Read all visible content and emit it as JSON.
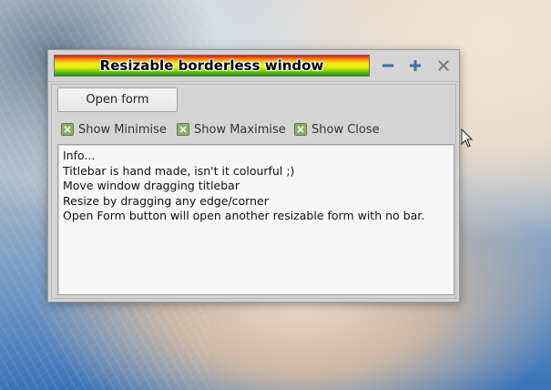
{
  "window": {
    "title": "Resizable borderless window",
    "title_gradient_colors": [
      "#e3151a",
      "#f8a012",
      "#f8e814",
      "#7cc80a",
      "#139a14"
    ],
    "titlebar_buttons": [
      {
        "name": "minimize",
        "icon": "minus-icon"
      },
      {
        "name": "maximize",
        "icon": "plus-icon"
      },
      {
        "name": "close",
        "icon": "close-icon"
      }
    ]
  },
  "form": {
    "open_form_label": "Open form",
    "checkboxes": [
      {
        "label": "Show Minimise",
        "checked": true
      },
      {
        "label": "Show Maximise",
        "checked": true
      },
      {
        "label": "Show Close",
        "checked": true
      }
    ],
    "info_lines": [
      "Info...",
      "Titlebar is hand made, isn't it colourful ;)",
      "Move window dragging titlebar",
      "Resize by dragging any edge/corner",
      "Open Form button will open another resizable form with no bar."
    ]
  },
  "colors": {
    "checkbox_fill": "#8fae6e",
    "button_icon_blue": "#3f6ea6",
    "close_icon_gray": "#7b7b7b"
  }
}
